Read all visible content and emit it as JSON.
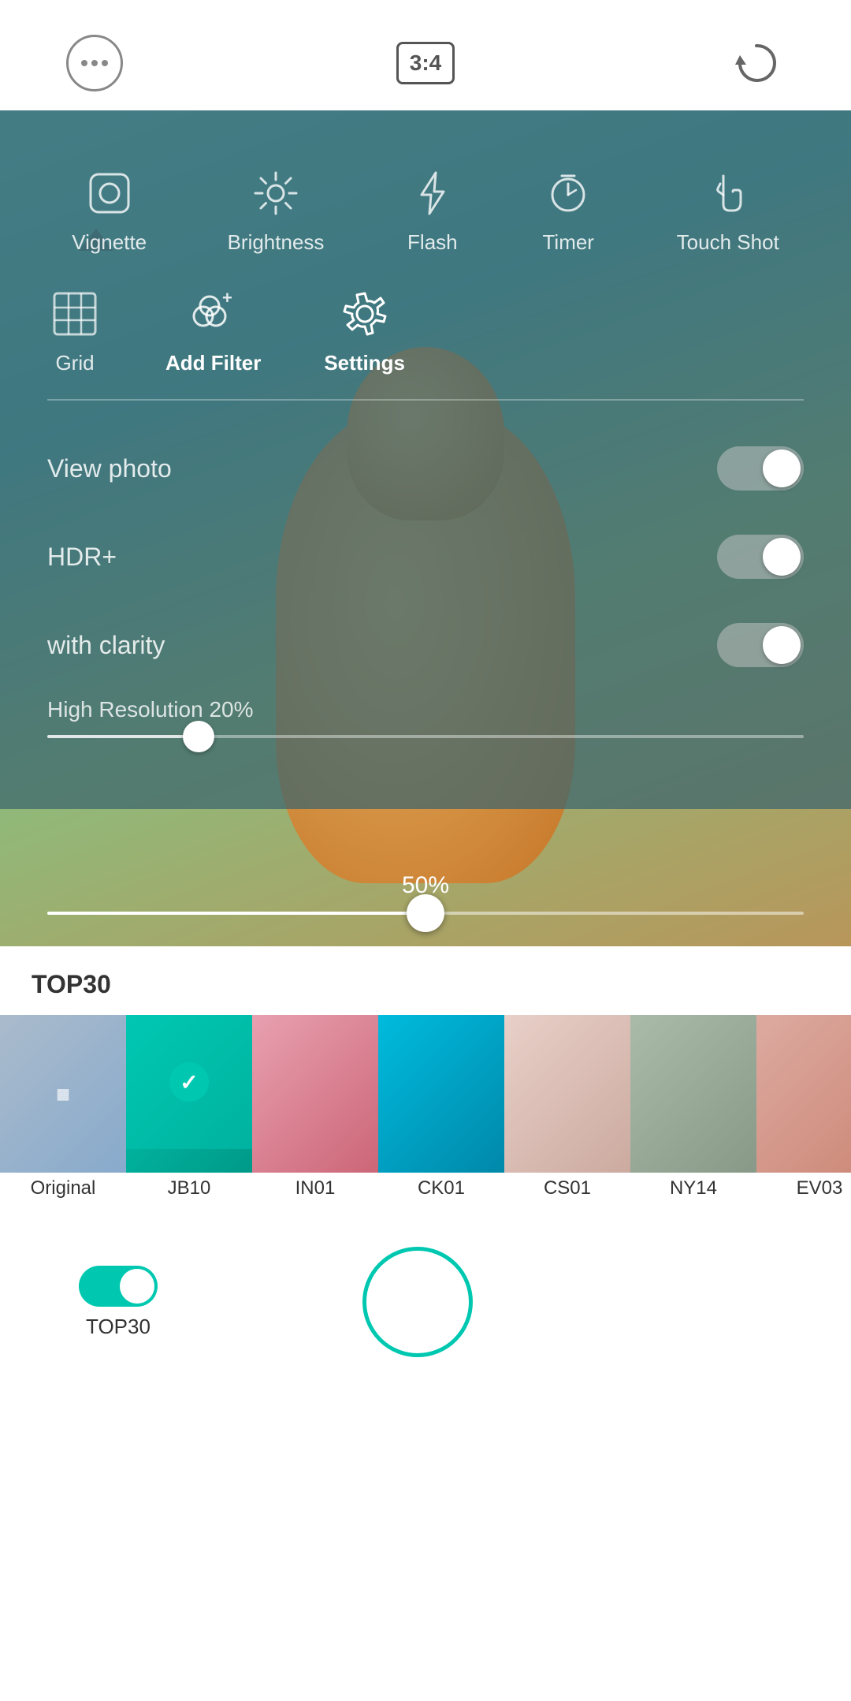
{
  "topBar": {
    "moreLabel": "more",
    "ratioLabel": "3:4",
    "refreshLabel": "refresh"
  },
  "quickActions": [
    {
      "id": "vignette",
      "label": "Vignette"
    },
    {
      "id": "brightness",
      "label": "Brightness"
    },
    {
      "id": "flash",
      "label": "Flash"
    },
    {
      "id": "timer",
      "label": "Timer"
    },
    {
      "id": "touch-shot",
      "label": "Touch Shot"
    }
  ],
  "tools": [
    {
      "id": "grid",
      "label": "Grid",
      "active": false
    },
    {
      "id": "add-filter",
      "label": "Add Filter",
      "active": false
    },
    {
      "id": "settings",
      "label": "Settings",
      "active": true
    }
  ],
  "settings": [
    {
      "id": "view-photo",
      "label": "View photo",
      "state": "off"
    },
    {
      "id": "hdr",
      "label": "HDR+",
      "state": "off"
    },
    {
      "id": "clarity",
      "label": "with clarity",
      "state": "off"
    }
  ],
  "highResolution": {
    "label": "High Resolution 20%",
    "value": 20
  },
  "exposure": {
    "percent": "50%",
    "value": 50
  },
  "filterSection": {
    "title": "TOP30",
    "filters": [
      {
        "id": "original",
        "label": "Original",
        "color": "#8899aa",
        "selected": false
      },
      {
        "id": "jb10",
        "label": "JB10",
        "color": "#00c8b0",
        "selected": true
      },
      {
        "id": "in01",
        "label": "IN01",
        "color": "#cc8899",
        "selected": false
      },
      {
        "id": "ck01",
        "label": "CK01",
        "color": "#00bbcc",
        "selected": false
      },
      {
        "id": "cs01",
        "label": "CS01",
        "color": "#ddbbaa",
        "selected": false
      },
      {
        "id": "ny14",
        "label": "NY14",
        "color": "#aabbaa",
        "selected": false
      },
      {
        "id": "ev03",
        "label": "EV03",
        "color": "#cc9988",
        "selected": false
      },
      {
        "id": "more",
        "label": "...",
        "color": "#bbbbbb",
        "selected": false
      }
    ]
  },
  "bottomBar": {
    "toggleLabel": "TOP30",
    "shutterLabel": "shutter"
  }
}
